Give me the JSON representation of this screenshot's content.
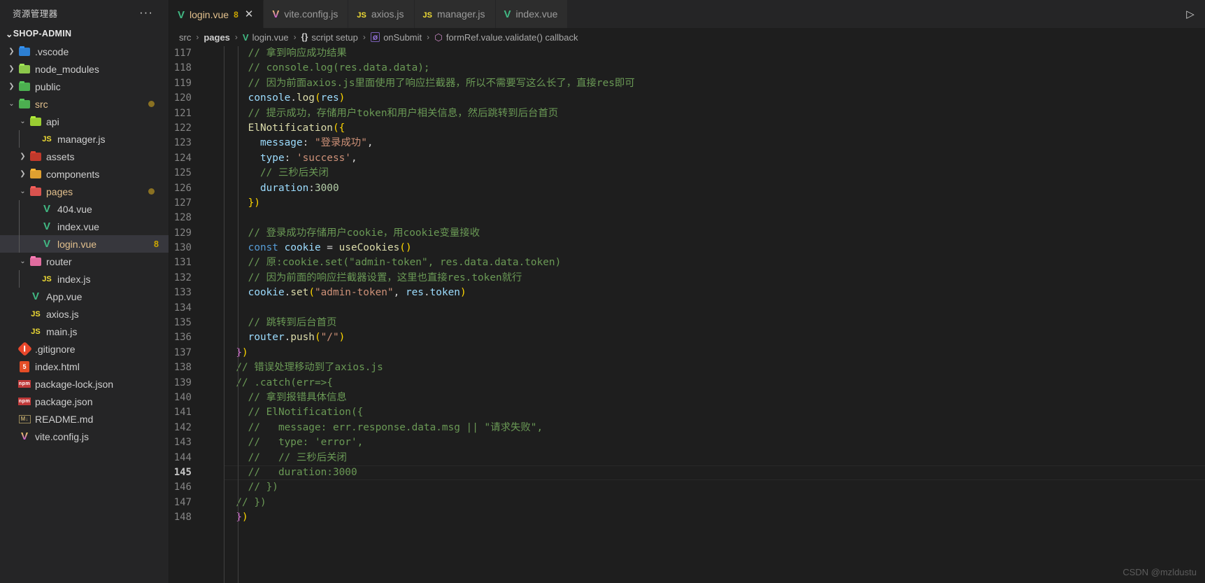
{
  "sidebar": {
    "header_title": "资源管理器",
    "more_actions": "···",
    "root_label": "SHOP-ADMIN",
    "items": [
      {
        "label": ".vscode",
        "icon": "vscode-folder-icon",
        "depth": 1,
        "chev": "›",
        "kind": "folder",
        "color": "#2d7fd3"
      },
      {
        "label": "node_modules",
        "icon": "node-folder-icon",
        "depth": 1,
        "chev": "›",
        "kind": "folder",
        "color": "#8cc84b"
      },
      {
        "label": "public",
        "icon": "public-folder-icon",
        "depth": 1,
        "chev": "›",
        "kind": "folder",
        "color": "#4caf50"
      },
      {
        "label": "src",
        "icon": "src-folder-icon",
        "depth": 1,
        "chev": "⌄",
        "kind": "folder",
        "color": "#4caf50",
        "modified": true,
        "dot": true
      },
      {
        "label": "api",
        "icon": "api-folder-icon",
        "depth": 2,
        "chev": "⌄",
        "kind": "folder",
        "color": "#9acd32"
      },
      {
        "label": "manager.js",
        "icon": "js-file-icon",
        "depth": 3,
        "chev": "",
        "kind": "js"
      },
      {
        "label": "assets",
        "icon": "assets-folder-icon",
        "depth": 2,
        "chev": "›",
        "kind": "folder",
        "color": "#c0392b"
      },
      {
        "label": "components",
        "icon": "components-folder-icon",
        "depth": 2,
        "chev": "›",
        "kind": "folder",
        "color": "#e0a030"
      },
      {
        "label": "pages",
        "icon": "pages-folder-icon",
        "depth": 2,
        "chev": "⌄",
        "kind": "folder",
        "color": "#d9534f",
        "modified": true,
        "dot": true
      },
      {
        "label": "404.vue",
        "icon": "vue-file-icon",
        "depth": 3,
        "chev": "",
        "kind": "vue"
      },
      {
        "label": "index.vue",
        "icon": "vue-file-icon",
        "depth": 3,
        "chev": "",
        "kind": "vue"
      },
      {
        "label": "login.vue",
        "icon": "vue-file-icon",
        "depth": 3,
        "chev": "",
        "kind": "vue",
        "selected": true,
        "dirty": true,
        "badge": "8"
      },
      {
        "label": "router",
        "icon": "router-folder-icon",
        "depth": 2,
        "chev": "⌄",
        "kind": "folder",
        "color": "#e06c9f"
      },
      {
        "label": "index.js",
        "icon": "js-file-icon",
        "depth": 3,
        "chev": "",
        "kind": "js"
      },
      {
        "label": "App.vue",
        "icon": "vue-file-icon",
        "depth": 2,
        "chev": "",
        "kind": "vue"
      },
      {
        "label": "axios.js",
        "icon": "js-file-icon",
        "depth": 2,
        "chev": "",
        "kind": "js"
      },
      {
        "label": "main.js",
        "icon": "js-file-icon",
        "depth": 2,
        "chev": "",
        "kind": "js"
      },
      {
        "label": ".gitignore",
        "icon": "git-file-icon",
        "depth": 1,
        "chev": "",
        "kind": "git"
      },
      {
        "label": "index.html",
        "icon": "html-file-icon",
        "depth": 1,
        "chev": "",
        "kind": "html"
      },
      {
        "label": "package-lock.json",
        "icon": "npm-file-icon",
        "depth": 1,
        "chev": "",
        "kind": "npm"
      },
      {
        "label": "package.json",
        "icon": "npm-file-icon",
        "depth": 1,
        "chev": "",
        "kind": "npm"
      },
      {
        "label": "README.md",
        "icon": "markdown-file-icon",
        "depth": 1,
        "chev": "",
        "kind": "md"
      },
      {
        "label": "vite.config.js",
        "icon": "vite-file-icon",
        "depth": 1,
        "chev": "",
        "kind": "vite"
      }
    ]
  },
  "tabs": [
    {
      "label": "login.vue",
      "icon": "vue-file-icon",
      "active": true,
      "badge": "8",
      "close": "✕"
    },
    {
      "label": "vite.config.js",
      "icon": "vite-file-icon",
      "active": false
    },
    {
      "label": "axios.js",
      "icon": "js-file-icon",
      "active": false
    },
    {
      "label": "manager.js",
      "icon": "js-file-icon",
      "active": false
    },
    {
      "label": "index.vue",
      "icon": "vue-file-icon",
      "active": false
    }
  ],
  "toolbar": {
    "run_icon": "▷",
    "run_label": "run-and-debug"
  },
  "breadcrumb": [
    {
      "text": "src",
      "icon": "",
      "bold": false
    },
    {
      "text": "pages",
      "icon": "",
      "bold": true
    },
    {
      "text": "login.vue",
      "icon": "vue-icon",
      "bold": false
    },
    {
      "text": "script setup",
      "icon": "braces-icon",
      "bold": false
    },
    {
      "text": "onSubmit",
      "icon": "method-icon",
      "bold": false
    },
    {
      "text": "formRef.value.validate() callback",
      "icon": "cube-icon",
      "bold": false
    }
  ],
  "breadcrumb_separator": "›",
  "editor": {
    "current_line": 145,
    "first_line": 117,
    "lines": [
      {
        "n": 117,
        "tokens": [
          {
            "t": "    ",
            "c": "pn"
          },
          {
            "t": "// 拿到响应成功结果",
            "c": "cm"
          }
        ]
      },
      {
        "n": 118,
        "tokens": [
          {
            "t": "    ",
            "c": "pn"
          },
          {
            "t": "// console.log(res.data.data);",
            "c": "cm"
          }
        ]
      },
      {
        "n": 119,
        "tokens": [
          {
            "t": "    ",
            "c": "pn"
          },
          {
            "t": "// 因为前面axios.js里面使用了响应拦截器，所以不需要写这么长了，直接res即可",
            "c": "cm"
          }
        ]
      },
      {
        "n": 120,
        "tokens": [
          {
            "t": "    ",
            "c": "pn"
          },
          {
            "t": "console",
            "c": "var"
          },
          {
            "t": ".",
            "c": "pn"
          },
          {
            "t": "log",
            "c": "fn"
          },
          {
            "t": "(",
            "c": "pl"
          },
          {
            "t": "res",
            "c": "var"
          },
          {
            "t": ")",
            "c": "pl"
          }
        ]
      },
      {
        "n": 121,
        "tokens": [
          {
            "t": "    ",
            "c": "pn"
          },
          {
            "t": "// 提示成功，存储用户token和用户相关信息，然后跳转到后台首页",
            "c": "cm"
          }
        ]
      },
      {
        "n": 122,
        "tokens": [
          {
            "t": "    ",
            "c": "pn"
          },
          {
            "t": "ElNotification",
            "c": "fn"
          },
          {
            "t": "(",
            "c": "pl"
          },
          {
            "t": "{",
            "c": "pl"
          }
        ]
      },
      {
        "n": 123,
        "tokens": [
          {
            "t": "      ",
            "c": "pn"
          },
          {
            "t": "message",
            "c": "var"
          },
          {
            "t": ": ",
            "c": "pn"
          },
          {
            "t": "\"登录成功\"",
            "c": "str"
          },
          {
            "t": ",",
            "c": "pn"
          }
        ]
      },
      {
        "n": 124,
        "tokens": [
          {
            "t": "      ",
            "c": "pn"
          },
          {
            "t": "type",
            "c": "var"
          },
          {
            "t": ": ",
            "c": "pn"
          },
          {
            "t": "'success'",
            "c": "str"
          },
          {
            "t": ",",
            "c": "pn"
          }
        ]
      },
      {
        "n": 125,
        "tokens": [
          {
            "t": "      ",
            "c": "pn"
          },
          {
            "t": "// 三秒后关闭",
            "c": "cm"
          }
        ]
      },
      {
        "n": 126,
        "tokens": [
          {
            "t": "      ",
            "c": "pn"
          },
          {
            "t": "duration",
            "c": "var"
          },
          {
            "t": ":",
            "c": "pn"
          },
          {
            "t": "3000",
            "c": "num"
          }
        ]
      },
      {
        "n": 127,
        "tokens": [
          {
            "t": "    ",
            "c": "pn"
          },
          {
            "t": "}",
            "c": "pl"
          },
          {
            "t": ")",
            "c": "pl"
          }
        ]
      },
      {
        "n": 128,
        "tokens": []
      },
      {
        "n": 129,
        "tokens": [
          {
            "t": "    ",
            "c": "pn"
          },
          {
            "t": "// 登录成功存储用户cookie，用cookie变量接收",
            "c": "cm"
          }
        ]
      },
      {
        "n": 130,
        "tokens": [
          {
            "t": "    ",
            "c": "pn"
          },
          {
            "t": "const",
            "c": "kw"
          },
          {
            "t": " ",
            "c": "pn"
          },
          {
            "t": "cookie",
            "c": "var"
          },
          {
            "t": " = ",
            "c": "pn"
          },
          {
            "t": "useCookies",
            "c": "fn"
          },
          {
            "t": "(",
            "c": "pl"
          },
          {
            "t": ")",
            "c": "pl"
          }
        ]
      },
      {
        "n": 131,
        "tokens": [
          {
            "t": "    ",
            "c": "pn"
          },
          {
            "t": "// 原:cookie.set(\"admin-token\", res.data.data.token)",
            "c": "cm"
          }
        ]
      },
      {
        "n": 132,
        "tokens": [
          {
            "t": "    ",
            "c": "pn"
          },
          {
            "t": "// 因为前面的响应拦截器设置，这里也直接res.token就行",
            "c": "cm"
          }
        ]
      },
      {
        "n": 133,
        "tokens": [
          {
            "t": "    ",
            "c": "pn"
          },
          {
            "t": "cookie",
            "c": "var"
          },
          {
            "t": ".",
            "c": "pn"
          },
          {
            "t": "set",
            "c": "fn"
          },
          {
            "t": "(",
            "c": "pl"
          },
          {
            "t": "\"admin-token\"",
            "c": "str"
          },
          {
            "t": ", ",
            "c": "pn"
          },
          {
            "t": "res",
            "c": "var"
          },
          {
            "t": ".",
            "c": "pn"
          },
          {
            "t": "token",
            "c": "var"
          },
          {
            "t": ")",
            "c": "pl"
          }
        ]
      },
      {
        "n": 134,
        "tokens": []
      },
      {
        "n": 135,
        "tokens": [
          {
            "t": "    ",
            "c": "pn"
          },
          {
            "t": "// 跳转到后台首页",
            "c": "cm"
          }
        ]
      },
      {
        "n": 136,
        "tokens": [
          {
            "t": "    ",
            "c": "pn"
          },
          {
            "t": "router",
            "c": "var"
          },
          {
            "t": ".",
            "c": "pn"
          },
          {
            "t": "push",
            "c": "fn"
          },
          {
            "t": "(",
            "c": "pl"
          },
          {
            "t": "\"/\"",
            "c": "str"
          },
          {
            "t": ")",
            "c": "pl"
          }
        ]
      },
      {
        "n": 137,
        "tokens": [
          {
            "t": "  ",
            "c": "pn"
          },
          {
            "t": "}",
            "c": "pl2"
          },
          {
            "t": ")",
            "c": "pl"
          }
        ]
      },
      {
        "n": 138,
        "tokens": [
          {
            "t": "  ",
            "c": "pn"
          },
          {
            "t": "// 错误处理移动到了axios.js",
            "c": "cm"
          }
        ]
      },
      {
        "n": 139,
        "tokens": [
          {
            "t": "  ",
            "c": "pn"
          },
          {
            "t": "// .catch(err=>{",
            "c": "cm"
          }
        ]
      },
      {
        "n": 140,
        "tokens": [
          {
            "t": "    ",
            "c": "pn"
          },
          {
            "t": "// 拿到报错具体信息",
            "c": "cm"
          }
        ]
      },
      {
        "n": 141,
        "tokens": [
          {
            "t": "    ",
            "c": "pn"
          },
          {
            "t": "// ElNotification({",
            "c": "cm"
          }
        ]
      },
      {
        "n": 142,
        "tokens": [
          {
            "t": "    ",
            "c": "pn"
          },
          {
            "t": "//   message: err.response.data.msg || \"请求失败\",",
            "c": "cm"
          }
        ]
      },
      {
        "n": 143,
        "tokens": [
          {
            "t": "    ",
            "c": "pn"
          },
          {
            "t": "//   type: 'error',",
            "c": "cm"
          }
        ]
      },
      {
        "n": 144,
        "tokens": [
          {
            "t": "    ",
            "c": "pn"
          },
          {
            "t": "//   // 三秒后关闭",
            "c": "cm"
          }
        ]
      },
      {
        "n": 145,
        "tokens": [
          {
            "t": "    ",
            "c": "pn"
          },
          {
            "t": "//   duration:3000",
            "c": "cm"
          }
        ]
      },
      {
        "n": 146,
        "tokens": [
          {
            "t": "    ",
            "c": "pn"
          },
          {
            "t": "// })",
            "c": "cm"
          }
        ]
      },
      {
        "n": 147,
        "tokens": [
          {
            "t": "  ",
            "c": "pn"
          },
          {
            "t": "// })",
            "c": "cm"
          }
        ]
      },
      {
        "n": 148,
        "tokens": [
          {
            "t": "  ",
            "c": "pn"
          },
          {
            "t": "}",
            "c": "pl2"
          },
          {
            "t": ")",
            "c": "pl"
          }
        ]
      }
    ]
  },
  "watermark": "CSDN @mzldustu"
}
